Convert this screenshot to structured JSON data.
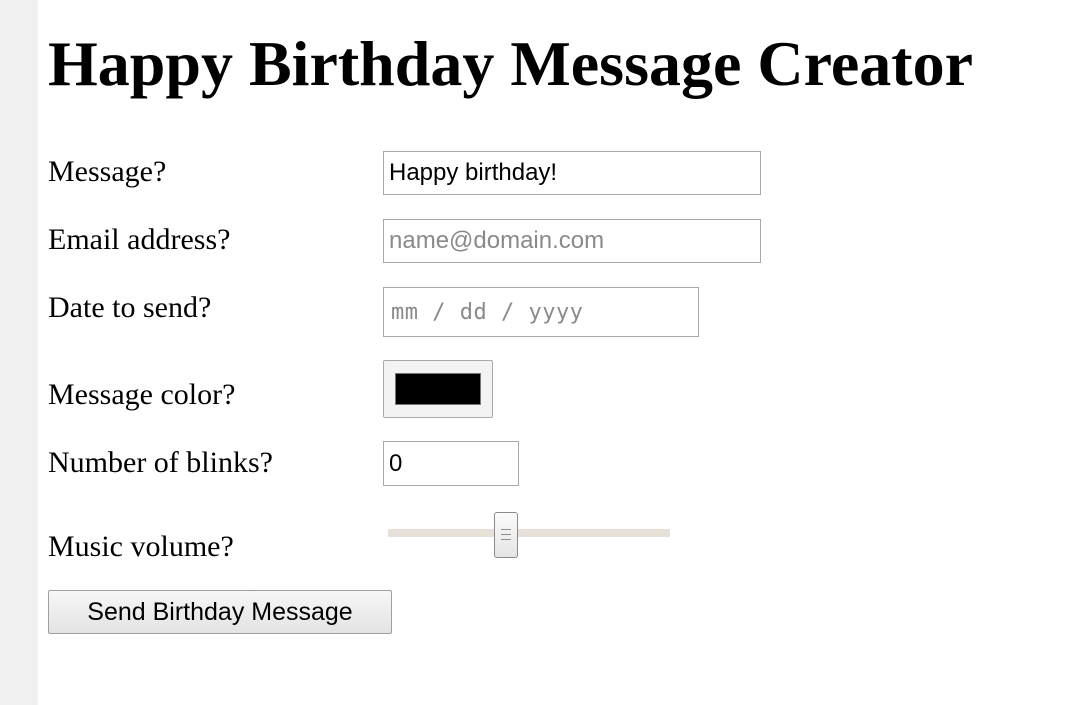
{
  "page": {
    "title": "Happy Birthday Message Creator"
  },
  "form": {
    "message": {
      "label": "Message?",
      "value": "Happy birthday!"
    },
    "email": {
      "label": "Email address?",
      "value": "",
      "placeholder": "name@domain.com"
    },
    "date": {
      "label": "Date to send?",
      "placeholder": "mm / dd / yyyy"
    },
    "color": {
      "label": "Message color?",
      "value": "#000000"
    },
    "blinks": {
      "label": "Number of blinks?",
      "value": "0"
    },
    "volume": {
      "label": "Music volume?",
      "value": 0.41
    },
    "submit_label": "Send Birthday Message"
  }
}
